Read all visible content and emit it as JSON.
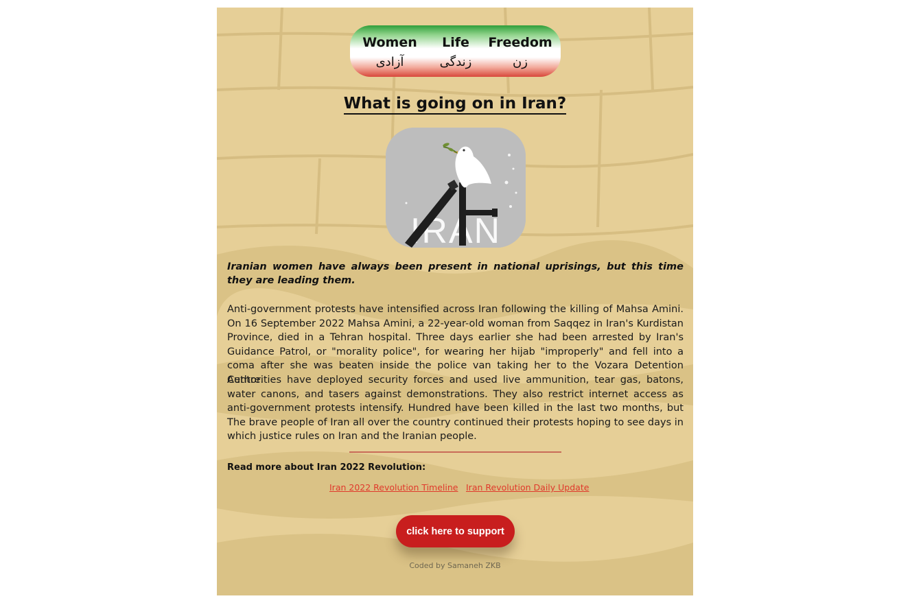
{
  "slogan": {
    "en": [
      "Women",
      "Life",
      "Freedom"
    ],
    "fa": [
      "آزادی",
      "زندگی",
      "زن"
    ],
    "gradient_top": "#2f9e3a",
    "gradient_bottom": "#d8473a"
  },
  "title": "What is going on in Iran?",
  "hero_image": {
    "caption": "IRAN",
    "icons": [
      "dove-icon",
      "olive-branch-icon",
      "broken-bars-icon"
    ]
  },
  "intro": "Iranian women have always been present in national uprisings, but this time they are leading them.",
  "paragraphs": [
    "Anti-government protests have intensified across Iran following the killing of Mahsa Amini. On 16 September 2022 Mahsa Amini, a 22-year-old woman from Saqqez in Iran's Kurdistan Province, died in a Tehran hospital. Three days earlier she had been arrested by Iran's Guidance Patrol, or \"morality police\", for wearing her hijab \"improperly\" and fell into a coma after she was beaten inside the police van taking her to the Vozara Detention Centre.",
    "Authorities have deployed security forces and used live ammunition, tear gas, batons, water canons, and tasers against demonstrations. They also restrict internet access as anti-government protests intensify. Hundred have been killed in the last two months, but The brave people of Iran all over the country continued their protests hoping to see days in which justice rules on Iran and the Iranian people."
  ],
  "read_more": {
    "heading": "Read more about Iran 2022 Revolution:",
    "links": [
      "Iran 2022 Revolution Timeline",
      "Iran Revolution Daily Update"
    ]
  },
  "support_button": "click here to support",
  "credit": "Coded by Samaneh ZKB",
  "colors": {
    "background": "#e9d39c",
    "accent_red": "#c81e1e",
    "link_red": "#e0392b",
    "divider": "#c86b58"
  }
}
